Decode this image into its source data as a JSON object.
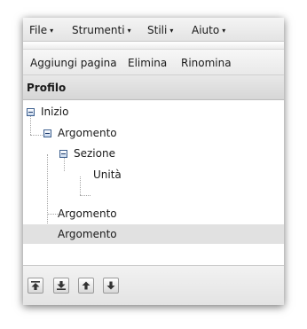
{
  "menubar": {
    "items": [
      {
        "label": "File"
      },
      {
        "label": "Strumenti"
      },
      {
        "label": "Stili"
      },
      {
        "label": "Aiuto"
      }
    ],
    "arrow_glyph": "▾"
  },
  "toolbar": {
    "add_page_label": "Aggiungi pagina",
    "delete_label": "Elimina",
    "rename_label": "Rinomina"
  },
  "outline": {
    "title": "Profilo",
    "nodes": [
      {
        "label": "Inizio",
        "level": 0,
        "expanded": true
      },
      {
        "label": "Argomento",
        "level": 1,
        "expanded": true
      },
      {
        "label": "Sezione",
        "level": 2,
        "expanded": true
      },
      {
        "label": "Unità",
        "level": 3
      },
      {
        "label": "Argomento",
        "level": 1
      },
      {
        "label": "Argomento",
        "level": 1,
        "selected": true
      }
    ]
  },
  "bottom_buttons": [
    {
      "icon": "move-to-top-icon"
    },
    {
      "icon": "move-to-bottom-icon"
    },
    {
      "icon": "move-up-icon"
    },
    {
      "icon": "move-down-icon"
    }
  ],
  "colors": {
    "selection": "#e1e1e1",
    "expander_border": "#3d5f8e"
  }
}
